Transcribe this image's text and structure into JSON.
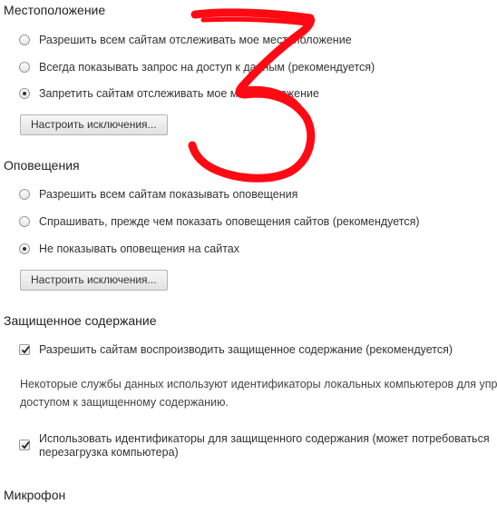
{
  "location": {
    "title": "Местоположение",
    "options": [
      {
        "label": "Разрешить всем сайтам отслеживать мое местоположение",
        "checked": false
      },
      {
        "label": "Всегда показывать запрос на доступ к данным (рекомендуется)",
        "checked": false
      },
      {
        "label": "Запретить сайтам отслеживать мое местоположение",
        "checked": true
      }
    ],
    "exceptions_button": "Настроить исключения..."
  },
  "notifications": {
    "title": "Оповещения",
    "options": [
      {
        "label": "Разрешить всем сайтам показывать оповещения",
        "checked": false
      },
      {
        "label": "Спрашивать, прежде чем показать оповещения сайтов (рекомендуется)",
        "checked": false
      },
      {
        "label": "Не показывать оповещения на сайтах",
        "checked": true
      }
    ],
    "exceptions_button": "Настроить исключения..."
  },
  "protected_content": {
    "title": "Защищенное содержание",
    "allow_playback": {
      "label": "Разрешить сайтам воспроизводить защищенное содержание (рекомендуется)",
      "checked": true
    },
    "info_line1": "Некоторые службы данных используют идентификаторы локальных компьютеров для управления",
    "info_line2": "доступом к защищенному содержанию.",
    "use_identifiers": {
      "label": "Использовать идентификаторы для защищенного содержания (может потребоваться перезагрузка компьютера)",
      "checked": true
    }
  },
  "microphone": {
    "title": "Микрофон"
  },
  "annotation": {
    "color": "#ff0a14",
    "glyph": "3"
  }
}
